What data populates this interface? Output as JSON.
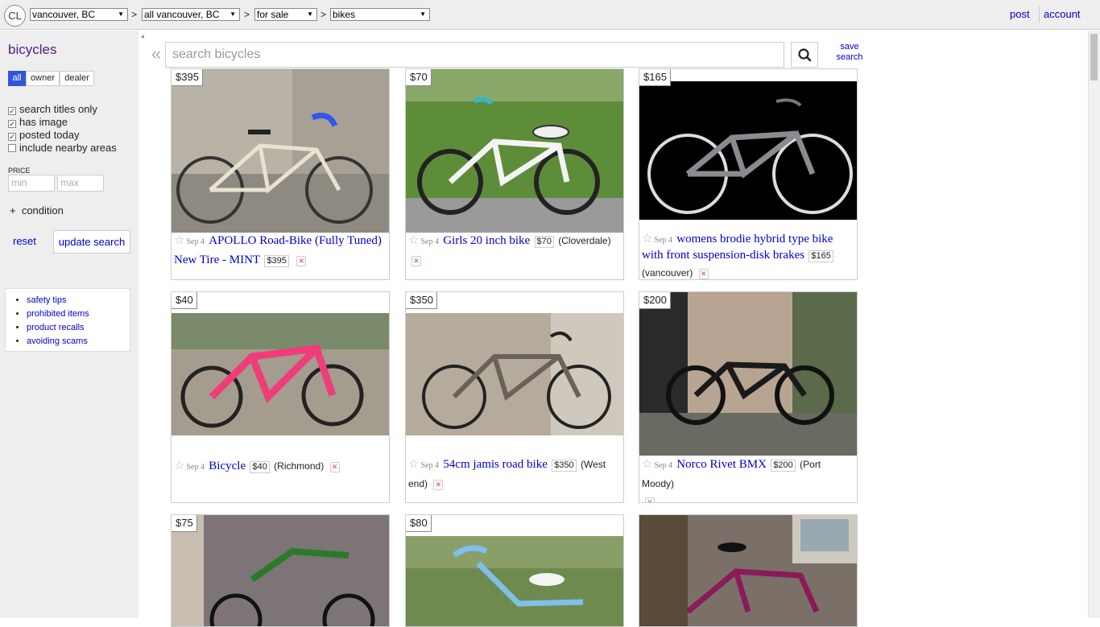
{
  "topbar": {
    "logo": "CL",
    "region": "vancouver, BC",
    "subarea": "all vancouver, BC",
    "section": "for sale",
    "category": "bikes",
    "sep": ">",
    "post": "post",
    "account": "account"
  },
  "sidebar": {
    "title": "bicycles",
    "segments": [
      "all",
      "owner",
      "dealer"
    ],
    "filters": [
      {
        "label": "search titles only",
        "checked": true
      },
      {
        "label": "has image",
        "checked": true
      },
      {
        "label": "posted today",
        "checked": true
      },
      {
        "label": "include nearby areas",
        "checked": false
      }
    ],
    "price_label": "PRICE",
    "min_placeholder": "min",
    "max_placeholder": "max",
    "condition": "condition",
    "condition_prefix": "+",
    "reset": "reset",
    "update": "update search",
    "links": [
      "safety tips",
      "prohibited items",
      "product recalls",
      "avoiding scams"
    ]
  },
  "search": {
    "placeholder": "search bicycles",
    "save_line1": "save",
    "save_line2": "search"
  },
  "listings": [
    {
      "price": "$395",
      "date": "Sep 4",
      "title": "APOLLO Road-Bike (Fully Tuned) New Tire - MINT",
      "badge": "$395",
      "location": ""
    },
    {
      "price": "$70",
      "date": "Sep 4",
      "title": "Girls 20 inch bike",
      "badge": "$70",
      "location": "(Cloverdale)"
    },
    {
      "price": "$165",
      "date": "Sep 4",
      "title": "womens brodie hybrid type bike with front suspension-disk brakes",
      "badge": "$165",
      "location": "(vancouver)"
    },
    {
      "price": "$40",
      "date": "Sep 4",
      "title": "Bicycle",
      "badge": "$40",
      "location": "(Richmond)"
    },
    {
      "price": "$350",
      "date": "Sep 4",
      "title": "54cm jamis road bike",
      "badge": "$350",
      "location": "(West end)"
    },
    {
      "price": "$200",
      "date": "Sep 4",
      "title": "Norco Rivet BMX",
      "badge": "$200",
      "location": "(Port Moody)"
    },
    {
      "price": "$75"
    },
    {
      "price": "$80"
    },
    {
      "price": ""
    }
  ]
}
